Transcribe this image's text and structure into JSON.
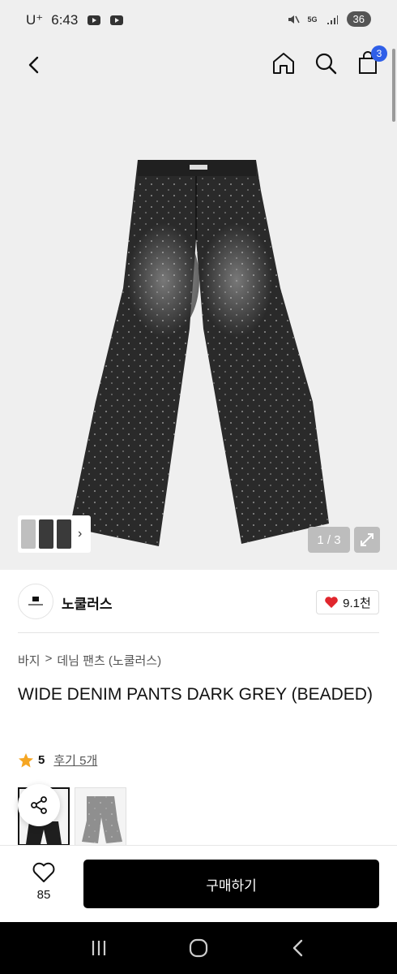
{
  "status_bar": {
    "carrier": "U⁺",
    "time": "6:43",
    "battery": "36",
    "network": "5G"
  },
  "header": {
    "cart_count": "3"
  },
  "gallery": {
    "counter": "1 / 3"
  },
  "brand": {
    "name": "노쿨러스",
    "likes": "9.1천"
  },
  "breadcrumb": {
    "category": "바지",
    "separator": ">",
    "subcategory": "데님 팬츠 (노쿨러스)"
  },
  "product": {
    "title": "WIDE DENIM PANTS DARK GREY (BEADED)",
    "rating": "5",
    "reviews": "후기 5개"
  },
  "purchase_bar": {
    "wish_count": "85",
    "buy_label": "구매하기"
  },
  "colors": {
    "accent_badge": "#2f5fe8",
    "heart": "#e0262d",
    "star": "#f5a623",
    "buy_button": "#000000"
  },
  "icons": [
    "back-icon",
    "home-icon",
    "search-icon",
    "cart-icon",
    "chevron-right-icon",
    "expand-icon",
    "heart-icon",
    "star-icon",
    "share-icon",
    "recent-apps-icon",
    "home-nav-icon",
    "back-nav-icon"
  ]
}
